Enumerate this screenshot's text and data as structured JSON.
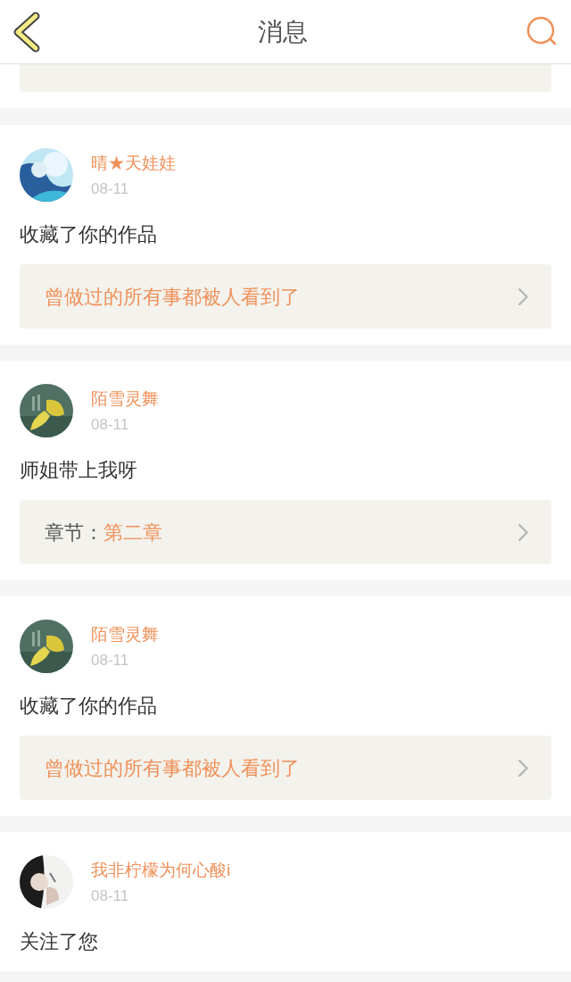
{
  "header": {
    "title": "消息"
  },
  "messages": [
    {
      "name": "晴★天娃娃",
      "date": "08-11",
      "text": "收藏了你的作品",
      "link": {
        "kind": "work",
        "text": "曾做过的所有事都被人看到了"
      }
    },
    {
      "name": "陌雪灵舞",
      "date": "08-11",
      "text": "师姐带上我呀",
      "link": {
        "kind": "chapter",
        "label": "章节：",
        "value": "第二章"
      }
    },
    {
      "name": "陌雪灵舞",
      "date": "08-11",
      "text": "收藏了你的作品",
      "link": {
        "kind": "work",
        "text": "曾做过的所有事都被人看到了"
      }
    },
    {
      "name": "我非柠檬为何心酸i",
      "date": "08-11",
      "text": "关注了您"
    }
  ]
}
